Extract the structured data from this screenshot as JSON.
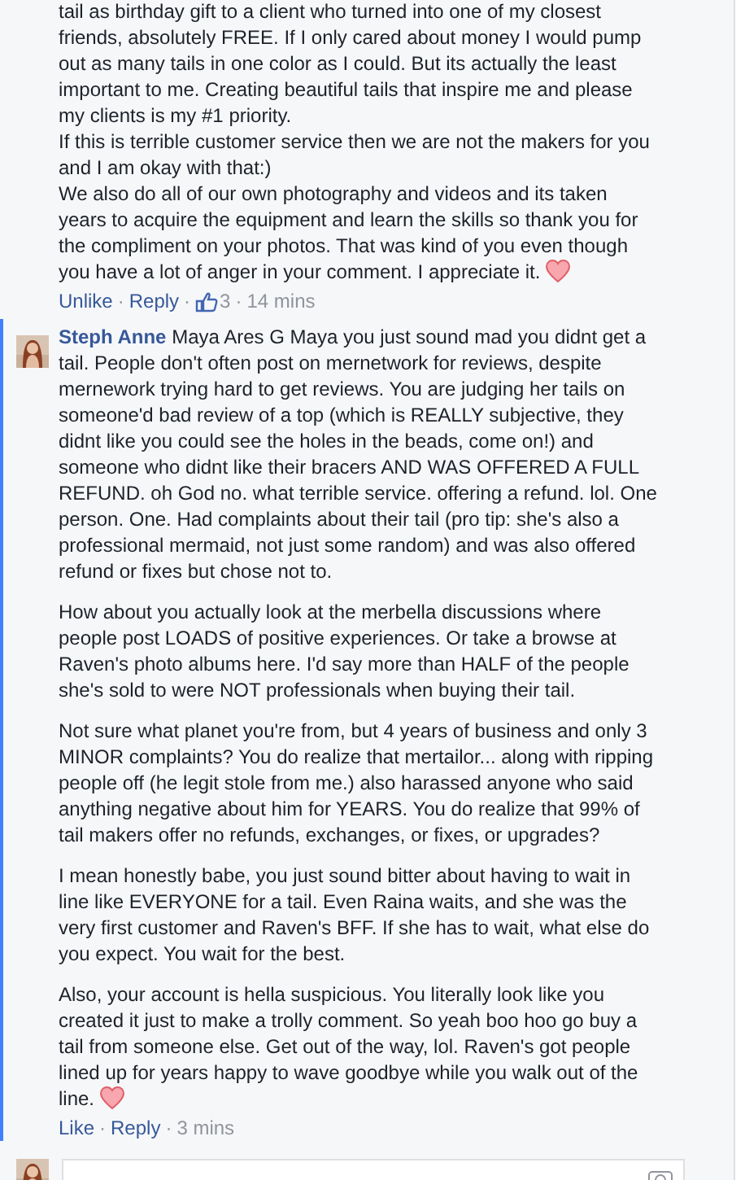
{
  "separator": "·",
  "comments": [
    {
      "highlighted": false,
      "avatar": false,
      "paragraphs": [
        "tail as birthday gift to a client who turned into one of my closest friends, absolutely FREE. If I only cared about money I would pump out as many tails in one color as I could. But its actually the least important to me. Creating beautiful tails that inspire me and please my clients is my #1 priority.\nIf this is terrible customer service then we are not the makers for you and I am okay with that:)\nWe also do all of our own photography and videos and its taken years to acquire the equipment and learn the skills so thank you for the compliment on your photos. That was kind of you even though you have a lot of anger in your comment. I appreciate it."
      ],
      "heart": true,
      "like_label": "Unlike",
      "reply_label": "Reply",
      "likes": "3",
      "time": "14 mins"
    },
    {
      "author": "Steph Anne",
      "highlighted": true,
      "avatar": true,
      "paragraphs": [
        "Maya Ares G Maya you just sound mad you didnt get a tail. People don't often post on mernetwork for reviews, despite mernework trying hard to get reviews. You are judging her tails on someone'd bad review of a top (which is REALLY subjective, they didnt like you could see the holes in the beads, come on!) and someone who didnt like their bracers AND WAS OFFERED A FULL REFUND. oh God no. what terrible service. offering a refund. lol. One person. One. Had complaints about their tail (pro tip: she's also a professional mermaid, not just some random) and was also offered refund or fixes but chose not to.",
        "How about you actually look at the merbella discussions where people post LOADS of positive experiences. Or take a browse at Raven's photo albums here. I'd say more than HALF of the people she's sold to were NOT professionals when buying their tail.",
        "Not sure what planet you're from, but 4 years of business and only 3 MINOR complaints? You do realize that mertailor... along with ripping people off (he legit stole from me.) also harassed anyone who said anything negative about him for YEARS. You do realize that 99% of tail makers offer no refunds, exchanges, or fixes, or upgrades?",
        "I mean honestly babe, you just sound bitter about having to wait in line like EVERYONE for a tail. Even Raina waits, and she was the very first customer and Raven's BFF. If she has to wait, what else do you expect. You wait for the best.",
        "Also, your account is hella suspicious. You literally look like you created it just to make a trolly comment. So yeah boo hoo go buy a tail from someone else. Get out of the way, lol. Raven's got people lined up for years happy to wave goodbye while you walk out of the line."
      ],
      "heart": true,
      "like_label": "Like",
      "reply_label": "Reply",
      "time": "3 mins"
    }
  ],
  "reply_box": {
    "avatar": true
  }
}
